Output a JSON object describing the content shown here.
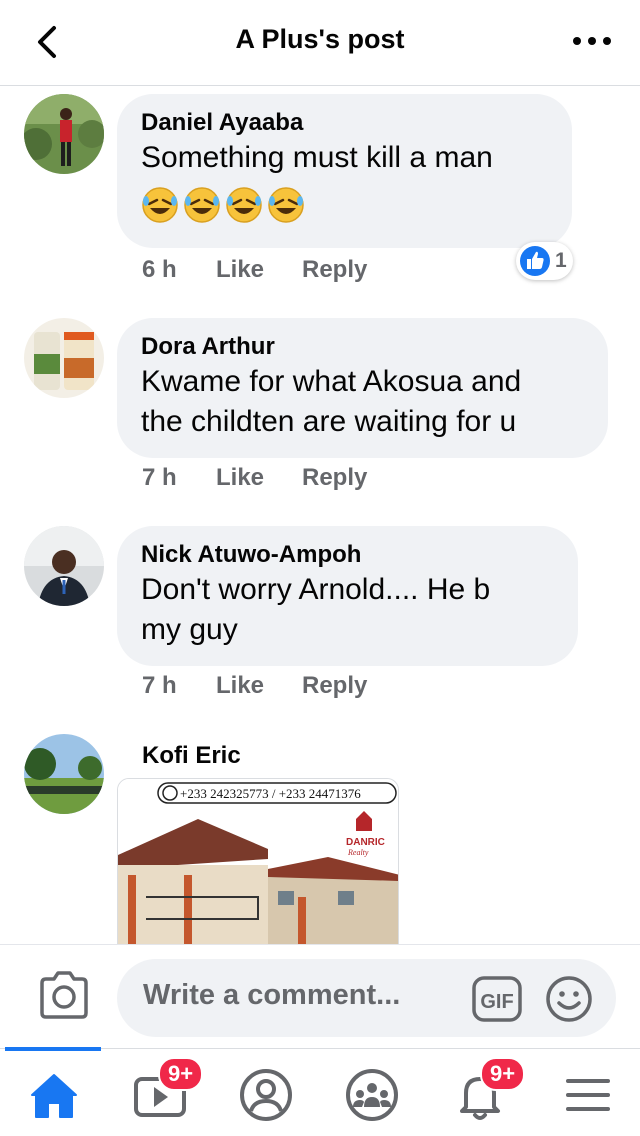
{
  "header": {
    "title": "A Plus's post"
  },
  "comments": [
    {
      "author": "Daniel Ayaaba",
      "text": "Something must kill a man",
      "emoji_count": 4,
      "time": "6 h",
      "like_label": "Like",
      "reply_label": "Reply",
      "reaction_count": "1"
    },
    {
      "author": "Dora Arthur",
      "text_line1": "Kwame for what Akosua and",
      "text_line2": "the childten are waiting for u",
      "time": "7 h",
      "like_label": "Like",
      "reply_label": "Reply"
    },
    {
      "author": "Nick Atuwo-Ampoh",
      "text_line1": "Don't worry Arnold.... He b",
      "text_line2": "my guy",
      "time": "7 h",
      "like_label": "Like",
      "reply_label": "Reply"
    },
    {
      "author": "Kofi Eric",
      "image_phone_text": "+233 242325773 / +233 24471376",
      "image_brand_line1": "DANRIC",
      "image_brand_line2": "Realty"
    }
  ],
  "composer": {
    "placeholder": "Write a comment...",
    "gif_label": "GIF"
  },
  "tabbar": {
    "watch_badge": "9+",
    "notifications_badge": "9+"
  },
  "colors": {
    "accent": "#1877f2",
    "badge": "#f02849",
    "bubble": "#f0f2f5",
    "secondary_text": "#65676b"
  }
}
